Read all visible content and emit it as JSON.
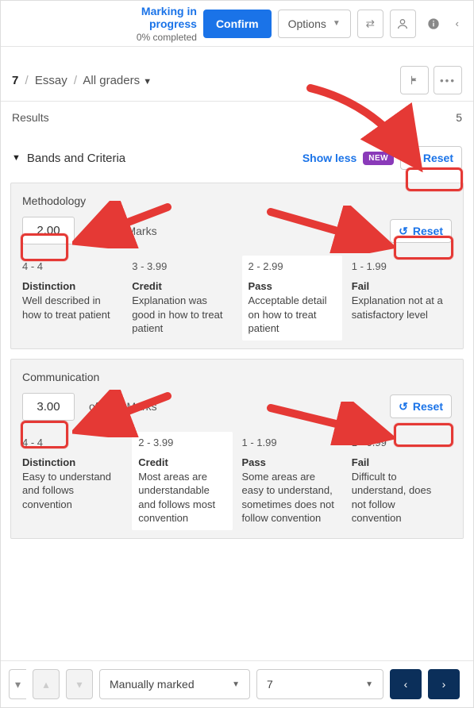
{
  "topbar": {
    "status_title": "Marking in progress",
    "status_sub": "0% completed",
    "confirm_label": "Confirm",
    "options_label": "Options"
  },
  "breadcrumb": {
    "item_num": "7",
    "type": "Essay",
    "graders": "All graders"
  },
  "results_row": {
    "label": "Results",
    "count": "5"
  },
  "bands_header": {
    "title": "Bands and Criteria",
    "show_less": "Show less",
    "new_badge": "NEW",
    "reset": "Reset"
  },
  "criteria": [
    {
      "name": "Methodology",
      "mark_value": "2.00",
      "range_label": "of 0 - 4 Marks",
      "reset": "Reset",
      "selected_index": 2,
      "bands": [
        {
          "range": "4 - 4",
          "name": "Distinction",
          "desc": "Well described in how to treat patient"
        },
        {
          "range": "3 - 3.99",
          "name": "Credit",
          "desc": "Explanation was good in how to treat patient"
        },
        {
          "range": "2 - 2.99",
          "name": "Pass",
          "desc": "Acceptable detail on how to treat patient"
        },
        {
          "range": "1 - 1.99",
          "name": "Fail",
          "desc": "Explanation not at a satisfactory level"
        }
      ]
    },
    {
      "name": "Communication",
      "mark_value": "3.00",
      "range_label": "of 0 - 4 Marks",
      "reset": "Reset",
      "selected_index": 1,
      "bands": [
        {
          "range": "4 - 4",
          "name": "Distinction",
          "desc": "Easy to understand and follows convention"
        },
        {
          "range": "2 - 3.99",
          "name": "Credit",
          "desc": "Most areas are understandable and follows most convention"
        },
        {
          "range": "1 - 1.99",
          "name": "Pass",
          "desc": "Some areas are easy to understand, sometimes does not follow convention"
        },
        {
          "range": "1 - 0.99",
          "name": "Fail",
          "desc": "Difficult to understand, does not follow convention"
        }
      ]
    }
  ],
  "bottom": {
    "filter_label": "Manually marked",
    "page_num": "7"
  }
}
